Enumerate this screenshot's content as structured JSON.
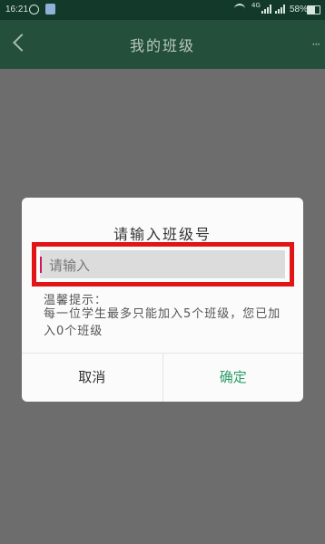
{
  "status_bar": {
    "time": "16:21",
    "network_a": "4G",
    "battery": "58%",
    "battery_level": 0.58,
    "icons": [
      "alarm-clock-icon",
      "app-icon",
      "wifi-icon",
      "signal-icon",
      "signal-icon",
      "battery-icon"
    ]
  },
  "header": {
    "title": "我的班级",
    "back_icon": "back-arrow-icon",
    "more_icon": "more-dots-icon",
    "more_symbol": "···"
  },
  "dialog": {
    "title": "请输入班级号",
    "input": {
      "value": "",
      "placeholder": "请输入"
    },
    "tip_label": "温馨提示：",
    "tip_text": "每一位学生最多只能加入5个班级，您已加入0个班级",
    "cancel_label": "取消",
    "confirm_label": "确定"
  },
  "colors": {
    "status_bar": "#13392a",
    "title_bar": "#244f3b",
    "confirm": "#2d9b68",
    "highlight": "#e11515",
    "caret": "#d2155f"
  }
}
